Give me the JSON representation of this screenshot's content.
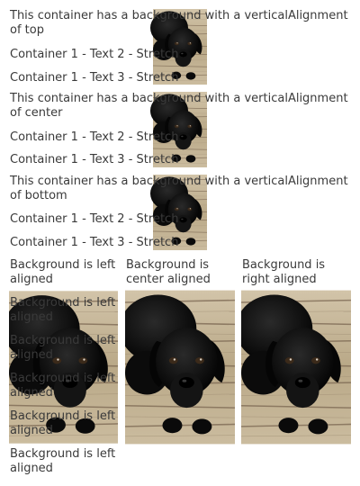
{
  "rows": [
    {
      "title": "This container has a background with a verticalAlignment of top",
      "line2": "Container 1 - Text 2 - Stretch",
      "line3": "Container 1 - Text 3 - Stretch"
    },
    {
      "title": "This container has a background with a verticalAlignment of center",
      "line2": "Container 1 - Text 2 - Stretch",
      "line3": "Container 1 - Text 3 - Stretch"
    },
    {
      "title": "This container has a background with a verticalAlignment of bottom",
      "line2": "Container 1 - Text 2 - Stretch",
      "line3": "Container 1 - Text 3 - Stretch"
    }
  ],
  "columns": {
    "left": {
      "items": [
        "Background is left aligned",
        "Background is left aligned",
        "Background is left aligned",
        "Background is left aligned",
        "Background is left aligned",
        "Background is left aligned"
      ]
    },
    "center": {
      "items": [
        "Background is center aligned"
      ]
    },
    "right": {
      "items": [
        "Background is right aligned"
      ]
    }
  },
  "colors": {
    "wood_light": "#c7b79a",
    "wood_dark": "#6e5a44",
    "dog_black": "#0d0d0d",
    "text": "#3a3a3a"
  },
  "image_subject": "black-puppy-on-wooden-deck"
}
